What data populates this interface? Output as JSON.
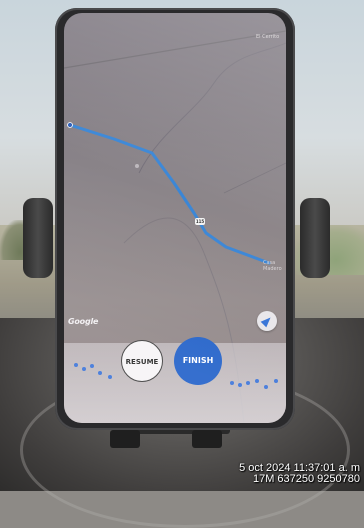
{
  "map": {
    "place_label_top": "El Cerrito",
    "place_label_casa_1": "Casa",
    "place_label_casa_2": "Madero",
    "road_label": "",
    "route_number": "115",
    "attribution": "Google",
    "route_color": "#3a86d6"
  },
  "controls": {
    "resume_label": "RESUME",
    "finish_label": "FINISH",
    "finish_color": "#1f5fc8",
    "recenter_icon": "navigation-arrow-icon"
  },
  "timestamp": {
    "line1": "5 oct 2024 11:37:01 a. m",
    "line2": "17M 637250 9250780"
  }
}
